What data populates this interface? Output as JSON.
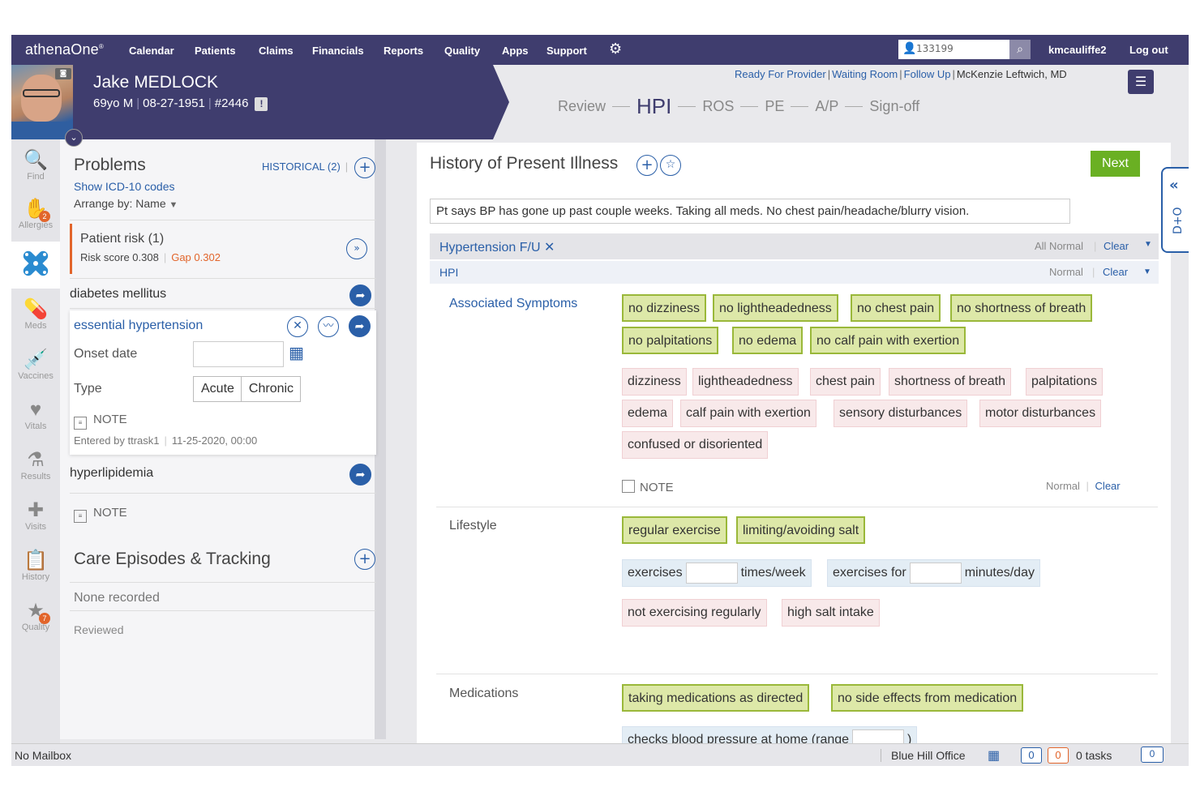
{
  "topnav": {
    "logo": "athenaOne",
    "items": [
      "Calendar",
      "Patients",
      "Claims",
      "Financials",
      "Reports",
      "Quality",
      "Apps",
      "Support"
    ],
    "search_value": "133199",
    "username": "kmcauliffe2",
    "logout": "Log out"
  },
  "patient": {
    "name": "Jake MEDLOCK",
    "age_sex": "69yo M",
    "dob": "08-27-1951",
    "id": "#2446",
    "alert": "!"
  },
  "status_links": {
    "ready": "Ready For Provider",
    "waiting": "Waiting Room",
    "follow": "Follow Up",
    "provider": "McKenzie Leftwich, MD"
  },
  "stepper": [
    "Review",
    "HPI",
    "ROS",
    "PE",
    "A/P",
    "Sign-off"
  ],
  "rail": [
    {
      "label": "Find",
      "icon": "find-icon"
    },
    {
      "label": "Allergies",
      "icon": "allergies-icon",
      "badge": "2"
    },
    {
      "label": "Meds",
      "icon": "meds-icon"
    },
    {
      "label": "Vaccines",
      "icon": "vaccines-icon"
    },
    {
      "label": "Vitals",
      "icon": "vitals-icon"
    },
    {
      "label": "Results",
      "icon": "results-icon"
    },
    {
      "label": "Visits",
      "icon": "visits-icon"
    },
    {
      "label": "History",
      "icon": "history-icon"
    },
    {
      "label": "Quality",
      "icon": "quality-icon",
      "badge": "7"
    }
  ],
  "problems": {
    "title": "Problems",
    "historical": "HISTORICAL (2)",
    "show_icd": "Show ICD-10 codes",
    "arrange": "Arrange by: Name",
    "risk_title": "Patient risk  (1)",
    "risk_score": "Risk score 0.308",
    "risk_gap": "Gap 0.302",
    "diabetes": "diabetes mellitus",
    "hypertension": "essential hypertension",
    "onset_label": "Onset date",
    "type_label": "Type",
    "type_acute": "Acute",
    "type_chronic": "Chronic",
    "note": "NOTE",
    "entered_by": "Entered by ttrask1",
    "entered_date": "11-25-2020, 00:00",
    "hyperlipidemia": "hyperlipidemia",
    "note2": "NOTE"
  },
  "care": {
    "title": "Care Episodes & Tracking",
    "none": "None recorded",
    "reviewed": "Reviewed"
  },
  "hpi": {
    "title": "History of Present Illness",
    "next": "Next",
    "summary": "Pt says BP has gone up past couple weeks. Taking all meds. No chest pain/headache/blurry vision.",
    "section": "Hypertension F/U",
    "all_normal": "All Normal",
    "clear": "Clear",
    "sub": "HPI",
    "normal": "Normal",
    "assoc_label": "Associated Symptoms",
    "assoc_neg": [
      "no dizziness",
      "no lightheadedness",
      "no chest pain",
      "no shortness of breath",
      "no palpitations",
      "no edema",
      "no calf pain with exertion"
    ],
    "assoc_pos": [
      "dizziness",
      "lightheadedness",
      "chest pain",
      "shortness of breath",
      "palpitations",
      "edema",
      "calf pain with exertion",
      "sensory disturbances",
      "motor disturbances",
      "confused or disoriented"
    ],
    "note": "NOTE",
    "note_normal": "Normal",
    "note_clear": "Clear",
    "lifestyle_label": "Lifestyle",
    "life_neg": [
      "regular exercise",
      "limiting/avoiding salt"
    ],
    "life_input_1a": "exercises",
    "life_input_1b": "times/week",
    "life_input_2a": "exercises for",
    "life_input_2b": "minutes/day",
    "life_pos": [
      "not exercising regularly",
      "high salt intake"
    ],
    "meds_label": "Medications",
    "meds_neg": [
      "taking medications as directed",
      "no side effects from medication"
    ],
    "meds_partial": "checks blood pressure at home (range"
  },
  "side_tab": {
    "label": "D+O"
  },
  "statusbar": {
    "mailbox": "No Mailbox",
    "office": "Blue Hill Office",
    "count_a": "0",
    "count_b": "0",
    "tasks": "0 tasks",
    "chat": "0"
  },
  "colors": {
    "nav": "#3f3d6e",
    "link": "#2a5fa8",
    "positive_chip": "#dde8a8",
    "negative_chip": "#f8e9ea",
    "next": "#6ab023",
    "alert": "#e2652b"
  }
}
